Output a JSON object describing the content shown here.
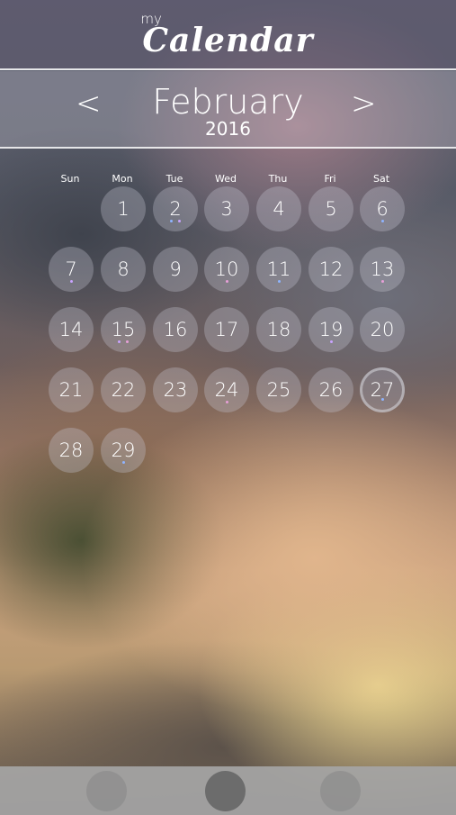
{
  "app": {
    "logo_prefix": "my",
    "logo_name": "Calendar"
  },
  "nav": {
    "prev_label": "<",
    "next_label": ">",
    "month": "February",
    "year": "2016"
  },
  "weekdays": [
    "Sun",
    "Mon",
    "Tue",
    "Wed",
    "Thu",
    "Fri",
    "Sat"
  ],
  "days": [
    {
      "label": "1",
      "dots": []
    },
    {
      "label": "2",
      "dots": [
        "#8fb4ff",
        "#c9a3ff"
      ]
    },
    {
      "label": "3",
      "dots": []
    },
    {
      "label": "4",
      "dots": []
    },
    {
      "label": "5",
      "dots": []
    },
    {
      "label": "6",
      "dots": [
        "#8fb4ff"
      ]
    },
    {
      "label": "7",
      "dots": [
        "#c9a3ff"
      ]
    },
    {
      "label": "8",
      "dots": []
    },
    {
      "label": "9",
      "dots": []
    },
    {
      "label": "10",
      "dots": [
        "#e7a0d8"
      ]
    },
    {
      "label": "11",
      "dots": [
        "#8fb4ff"
      ]
    },
    {
      "label": "12",
      "dots": []
    },
    {
      "label": "13",
      "dots": [
        "#e7a0d8"
      ]
    },
    {
      "label": "14",
      "dots": []
    },
    {
      "label": "15",
      "dots": [
        "#c9a3ff",
        "#e7a0d8"
      ]
    },
    {
      "label": "16",
      "dots": []
    },
    {
      "label": "17",
      "dots": []
    },
    {
      "label": "18",
      "dots": []
    },
    {
      "label": "19",
      "dots": [
        "#c9a3ff"
      ]
    },
    {
      "label": "20",
      "dots": []
    },
    {
      "label": "21",
      "dots": []
    },
    {
      "label": "22",
      "dots": []
    },
    {
      "label": "23",
      "dots": []
    },
    {
      "label": "24",
      "dots": [
        "#e7a0d8"
      ]
    },
    {
      "label": "25",
      "dots": []
    },
    {
      "label": "26",
      "dots": []
    },
    {
      "label": "27",
      "dots": [
        "#8fb4ff"
      ],
      "today": true
    },
    {
      "label": "28",
      "dots": []
    },
    {
      "label": "29",
      "dots": [
        "#8fb4ff"
      ]
    }
  ],
  "first_weekday_index": 1,
  "footer": {
    "buttons": [
      "left",
      "center",
      "right"
    ],
    "active": "center"
  }
}
